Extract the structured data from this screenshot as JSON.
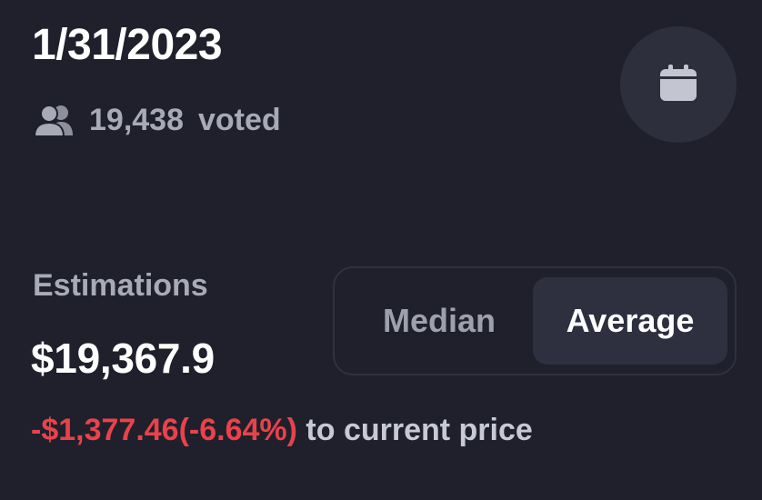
{
  "header": {
    "date": "1/31/2023",
    "voters_count": "19,438",
    "voters_label": "voted"
  },
  "icons": {
    "voters": "people-icon",
    "calendar_button": "calendar-icon"
  },
  "estimations": {
    "label": "Estimations",
    "value": "$19,367.9",
    "delta": "-$1,377.46(-6.64%)",
    "delta_suffix": "to current price"
  },
  "toggle": {
    "options": [
      "Median",
      "Average"
    ],
    "selected": "Average"
  },
  "colors": {
    "background": "#1f202b",
    "negative": "#e8424b",
    "muted_text": "#a8aab8",
    "active_segment": "#2e3040"
  }
}
